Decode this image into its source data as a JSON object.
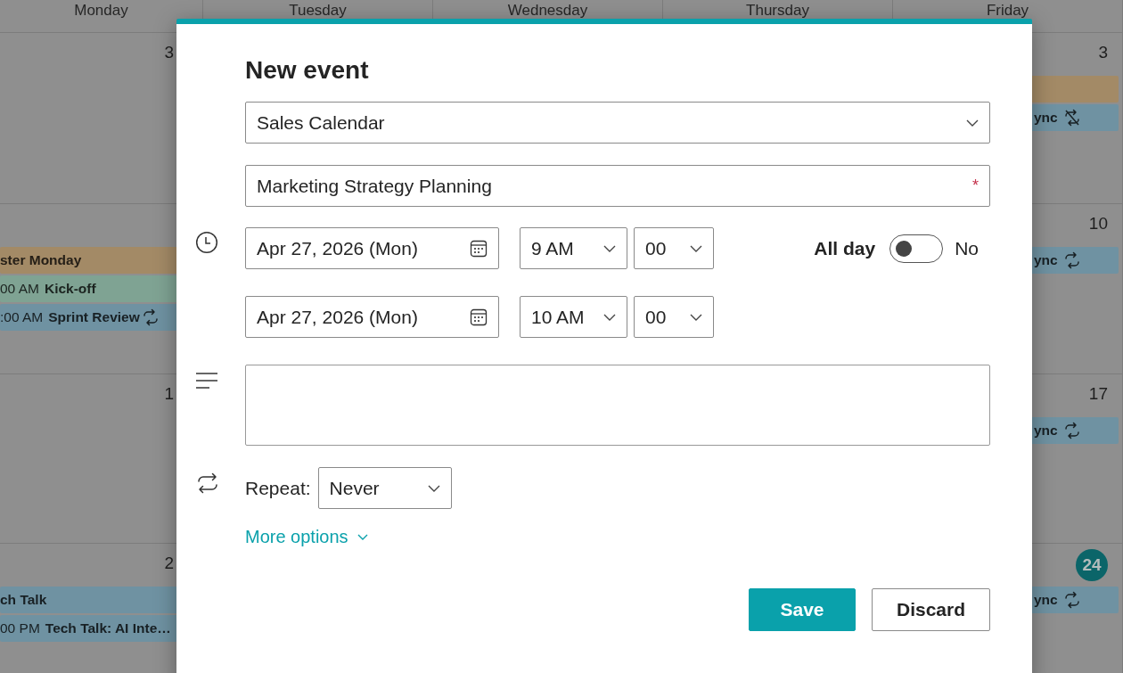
{
  "calendar": {
    "days": [
      "Monday",
      "Tuesday",
      "Wednesday",
      "Thursday",
      "Friday"
    ],
    "weeks": [
      {
        "monday": {
          "date": "3"
        },
        "friday": {
          "date": "3",
          "today": false,
          "events": [
            {
              "color": "#a38a66"
            },
            {
              "color": "#6f92a2",
              "title": "ync",
              "kind": "repeat-off"
            }
          ]
        }
      },
      {
        "monday": {
          "events": [
            {
              "color": "#a38a66",
              "title": "ster Monday"
            },
            {
              "color": "#7fa393",
              "time": "00 AM",
              "title": "Kick-off"
            },
            {
              "color": "#6f92a2",
              "time": ":00 AM",
              "title": "Sprint Review",
              "kind": "repeat"
            }
          ]
        },
        "friday": {
          "date": "10",
          "today": false,
          "events": [
            {
              "color": "#6f92a2",
              "title": "ync",
              "kind": "repeat"
            }
          ]
        }
      },
      {
        "monday": {
          "date": "1"
        },
        "friday": {
          "date": "17",
          "today": false,
          "events": [
            {
              "color": "#6f92a2",
              "title": "ync",
              "kind": "repeat"
            }
          ]
        }
      },
      {
        "monday": {
          "date": "2",
          "events": [
            {
              "color": "#6f92a2",
              "title": "ch Talk"
            },
            {
              "color": "#6f92a2",
              "time": "00 PM",
              "title": "Tech Talk: AI Inte…"
            }
          ]
        },
        "friday": {
          "date": "24",
          "today": true,
          "events": [
            {
              "color": "#6f92a2",
              "title": "ync",
              "kind": "repeat"
            }
          ]
        }
      }
    ]
  },
  "dialog": {
    "title": "New event",
    "calendar": "Sales Calendar",
    "event_title": "Marketing Strategy Planning",
    "required_mark": "*",
    "start": {
      "date": "Apr 27, 2026 (Mon)",
      "hour": "9 AM",
      "minute": "00"
    },
    "end": {
      "date": "Apr 27, 2026 (Mon)",
      "hour": "10 AM",
      "minute": "00"
    },
    "all_day": {
      "label": "All day",
      "on": false,
      "state_text": "No"
    },
    "repeat": {
      "label": "Repeat:",
      "value": "Never"
    },
    "more_options": "More options",
    "buttons": [
      {
        "label": "Save",
        "primary": true
      },
      {
        "label": "Discard",
        "primary": false
      }
    ]
  }
}
